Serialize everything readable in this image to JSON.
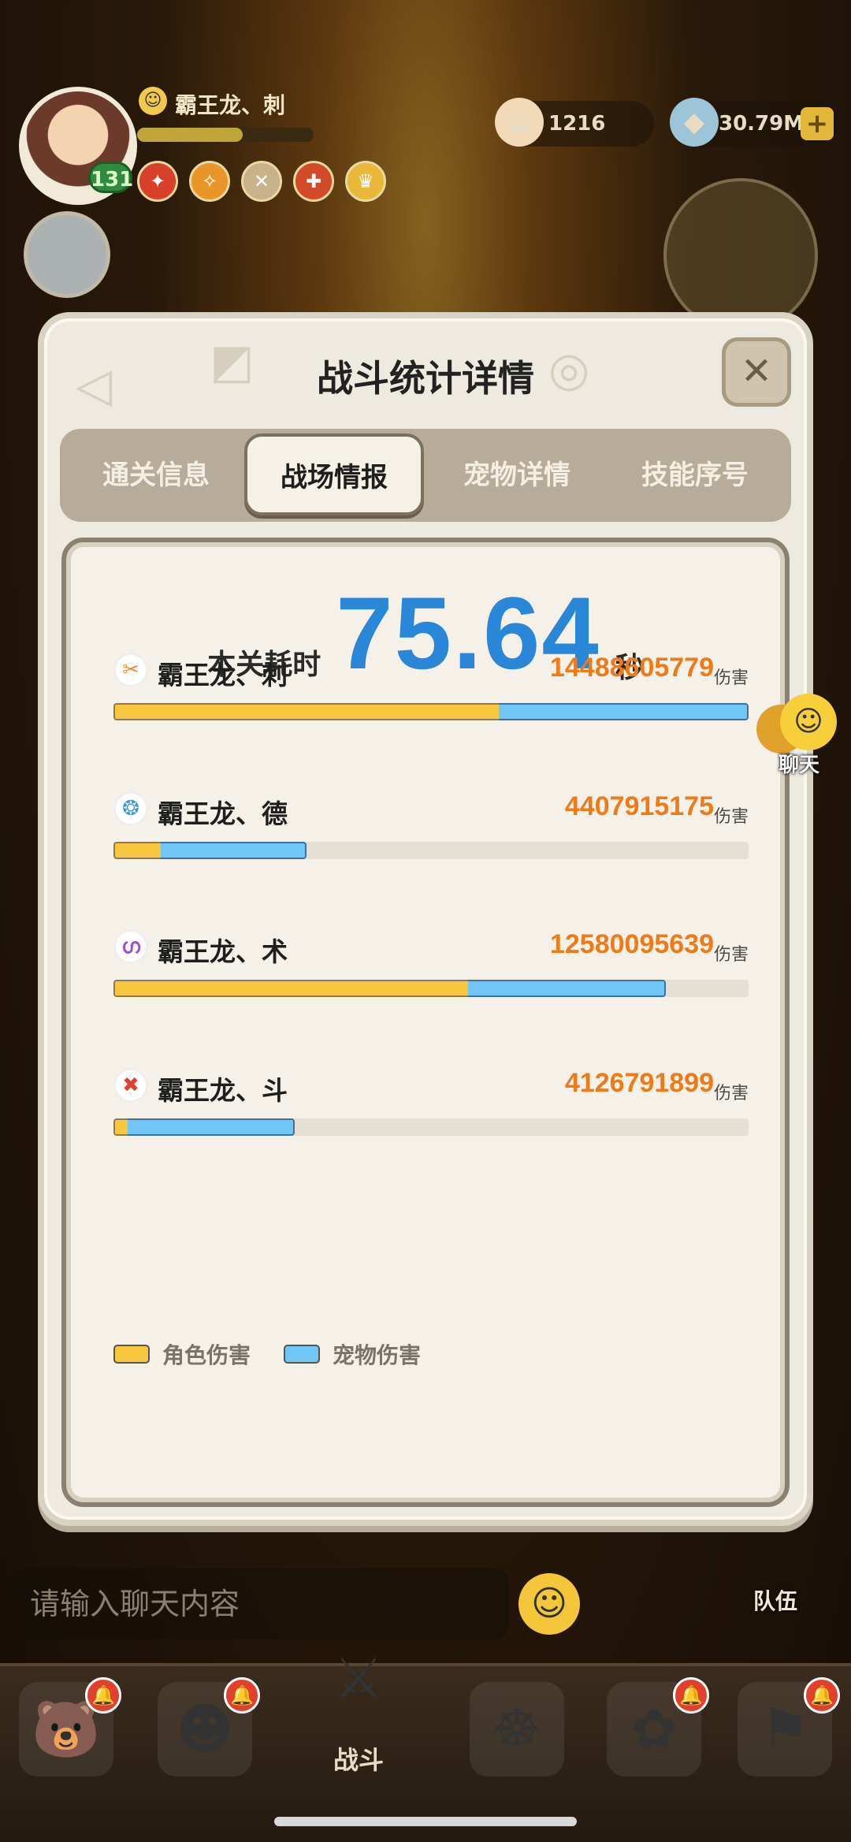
{
  "hud": {
    "player_name": "霸王龙、刺",
    "level": "131",
    "resource_1_value": "1216",
    "resource_2_value": "30.79M",
    "plus_label": "+"
  },
  "dialog": {
    "title": "战斗统计详情",
    "close_label": "✕",
    "tabs": [
      {
        "label": "通关信息",
        "active": false
      },
      {
        "label": "战场情报",
        "active": true
      },
      {
        "label": "宠物详情",
        "active": false
      },
      {
        "label": "技能序号",
        "active": false
      }
    ],
    "time": {
      "label": "本关耗时",
      "value": "75.64",
      "unit": "秒"
    },
    "damage_unit": "伤害",
    "rows": [
      {
        "name": "霸王龙、刺",
        "damage": "14488605779",
        "role_fraction": 0.607,
        "pet_fraction": 0.393,
        "total_fraction": 1.0,
        "icon": "blade-class-icon",
        "icon_color": "#f08a2a"
      },
      {
        "name": "霸王龙、德",
        "damage": "4407915175",
        "role_fraction": 0.074,
        "pet_fraction": 0.229,
        "total_fraction": 0.303,
        "icon": "druid-class-icon",
        "icon_color": "#3a9ad8"
      },
      {
        "name": "霸王龙、术",
        "damage": "12580095639",
        "role_fraction": 0.558,
        "pet_fraction": 0.311,
        "total_fraction": 0.869,
        "icon": "warlock-class-icon",
        "icon_color": "#9a4fd0"
      },
      {
        "name": "霸王龙、斗",
        "damage": "4126791899",
        "role_fraction": 0.022,
        "pet_fraction": 0.263,
        "total_fraction": 0.285,
        "icon": "fighter-class-icon",
        "icon_color": "#e2402f"
      }
    ],
    "legend": {
      "role_label": "角色伤害",
      "pet_label": "宠物伤害",
      "role_color": "#f7c73e",
      "pet_color": "#72c6f5"
    }
  },
  "chat_float": {
    "label": "聊天"
  },
  "chat_input": {
    "placeholder": "请输入聊天内容"
  },
  "team_label": "队伍",
  "bottom_nav": {
    "battle_label": "战斗"
  }
}
